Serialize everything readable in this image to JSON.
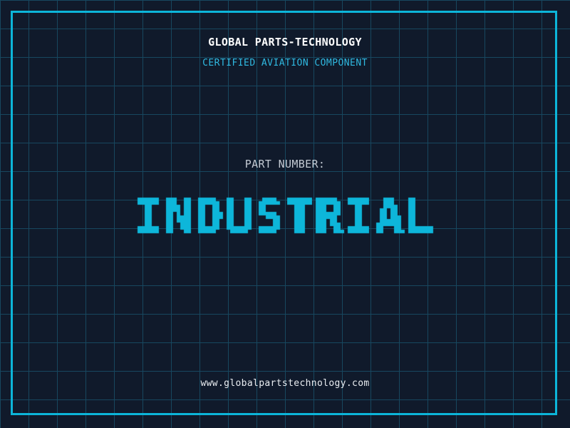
{
  "colors": {
    "background": "#101a2b",
    "grid_line": "#17475f",
    "frame": "#0cb5d9",
    "title": "#ffffff",
    "tagline": "#2fb9e1",
    "part_label": "#c3cad3",
    "part_value": "#0db6da",
    "website": "#e9edf1"
  },
  "header": {
    "company": "GLOBAL PARTS-TECHNOLOGY",
    "tagline": "CERTIFIED AVIATION COMPONENT"
  },
  "part": {
    "label": "PART NUMBER:",
    "value": "INDUSTRIAL"
  },
  "footer": {
    "website": "www.globalpartstechnology.com"
  }
}
